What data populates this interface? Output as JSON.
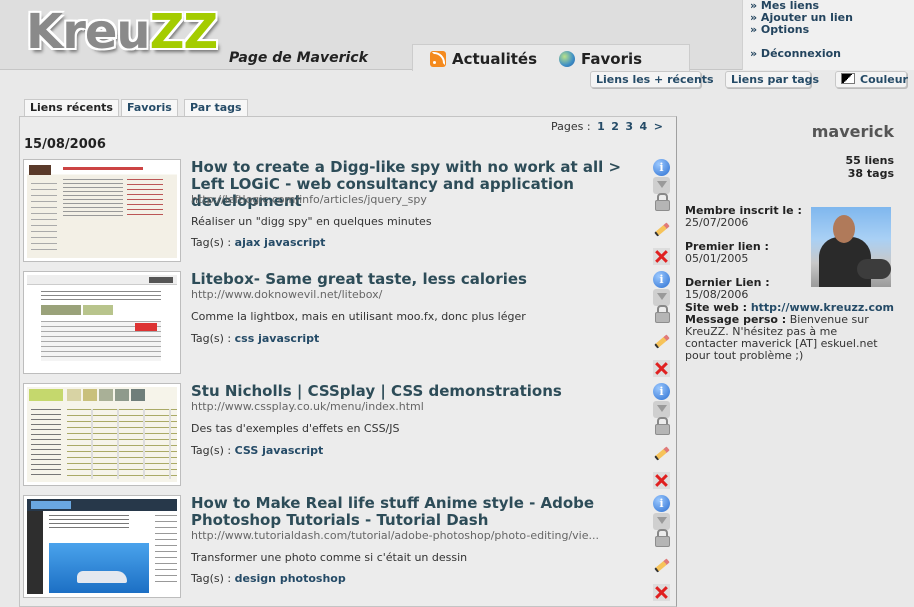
{
  "header": {
    "logo": {
      "part1": "Kreu",
      "part2": "ZZ"
    },
    "page_title": "Page de Maverick",
    "main_tabs": [
      {
        "label": "Actualités",
        "icon": "rss-icon"
      },
      {
        "label": "Favoris",
        "icon": "globe-icon"
      }
    ],
    "user_menu": [
      "» Mes liens",
      "» Ajouter un lien",
      "» Options",
      "» Déconnexion"
    ]
  },
  "subnav": {
    "recent": "Liens les + récents",
    "by_tags": "Liens par tags",
    "color": "Couleur"
  },
  "left_tabs": [
    "Liens récents",
    "Favoris",
    "Par tags"
  ],
  "pagination": {
    "label": "Pages :",
    "pages": [
      "1",
      "2",
      "3",
      "4",
      ">"
    ]
  },
  "date": "15/08/2006",
  "entries": [
    {
      "title": "How to create a Digg-like spy with no work at all > Left LOGiC - web consultancy and application development",
      "url": "http://leftlogic.com/info/articles/jquery_spy",
      "description": "Réaliser un \"digg spy\" en quelques minutes",
      "tags_label": "Tag(s) :",
      "tags": "ajax javascript"
    },
    {
      "title": "Litebox- Same great taste, less calories",
      "url": "http://www.doknowevil.net/litebox/",
      "description": "Comme la lightbox, mais en utilisant moo.fx, donc plus léger",
      "tags_label": "Tag(s) :",
      "tags": "css javascript"
    },
    {
      "title": "Stu Nicholls | CSSplay | CSS demonstrations",
      "url": "http://www.cssplay.co.uk/menu/index.html",
      "description": "Des tas d'exemples d'effets en CSS/JS",
      "tags_label": "Tag(s) :",
      "tags": "CSS javascript"
    },
    {
      "title": "How to Make Real life stuff Anime style - Adobe Photoshop Tutorials - Tutorial Dash",
      "url": "http://www.tutorialdash.com/tutorial/adobe-photoshop/photo-editing/vie...",
      "description": "Transformer une photo comme si c'était un dessin",
      "tags_label": "Tag(s) :",
      "tags": "design photoshop"
    }
  ],
  "profile": {
    "name": "maverick",
    "links_count": "55 liens",
    "tags_count": "38 tags",
    "member_label": "Membre inscrit le :",
    "member_date": "25/07/2006",
    "first_label": "Premier lien :",
    "first_date": "05/01/2005",
    "last_label": "Dernier Lien :",
    "last_date": "15/08/2006",
    "site_label": "Site web :",
    "site_url": "http://www.kreuzz.com",
    "perso_label": "Message perso :",
    "perso_text": "Bienvenue sur KreuZZ. N'hésitez pas à me contacter maverick [AT] eskuel.net pour tout problème ;)"
  },
  "colors": {
    "accent": "#254b67",
    "logo_green": "#a4cc00",
    "title": "#2d4c58"
  }
}
